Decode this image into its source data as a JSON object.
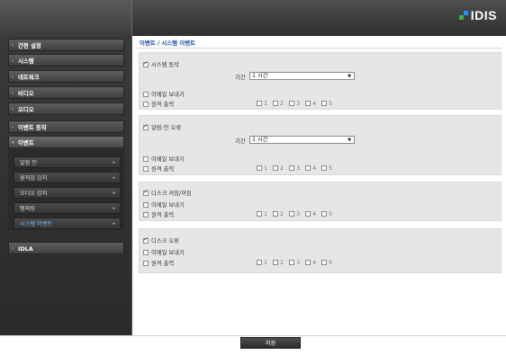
{
  "header": {
    "logo_text": "IDIS"
  },
  "sidebar": {
    "items": [
      {
        "label": "간편 설정"
      },
      {
        "label": "시스템"
      },
      {
        "label": "네트워크"
      },
      {
        "label": "비디오"
      },
      {
        "label": "오디오"
      },
      {
        "label": "이벤트 동작"
      },
      {
        "label": "이벤트"
      },
      {
        "label": "IDLA"
      }
    ],
    "submenu": [
      {
        "label": "알람 인"
      },
      {
        "label": "움직임 감지"
      },
      {
        "label": "오디오 감지"
      },
      {
        "label": "탬퍼링"
      },
      {
        "label": "시스템 이벤트"
      }
    ]
  },
  "main": {
    "breadcrumb": "이벤트 / 시스템 이벤트",
    "panels": [
      {
        "title": "시스템 동작",
        "checked": true,
        "duration_label": "기간",
        "duration_value": "1 시간",
        "email_label": "이메일 보내기",
        "relay_label": "원격 출력",
        "relays": [
          "1",
          "2",
          "3",
          "4",
          "5"
        ]
      },
      {
        "title": "알람-인 오류",
        "checked": true,
        "duration_label": "기간",
        "duration_value": "1 시간",
        "email_label": "이메일 보내기",
        "relay_label": "원격 출력",
        "relays": [
          "1",
          "2",
          "3",
          "4",
          "5"
        ]
      },
      {
        "title": "디스크 켜짐/꺼짐",
        "checked": true,
        "email_label": "이메일 보내기",
        "relay_label": "원격 출력",
        "relays": [
          "1",
          "2",
          "3",
          "4",
          "5"
        ]
      },
      {
        "title": "디스크 오류",
        "checked": true,
        "email_label": "이메일 보내기",
        "relay_label": "원격 출력",
        "relays": [
          "1",
          "2",
          "3",
          "4",
          "5"
        ]
      }
    ],
    "save_label": "저장"
  },
  "colors": {
    "breadcrumb": "#1a4fa3",
    "active_submenu": "#6fc3ff",
    "panel_bg": "#e6e6e6",
    "header_bg": "#3a3a3a"
  }
}
